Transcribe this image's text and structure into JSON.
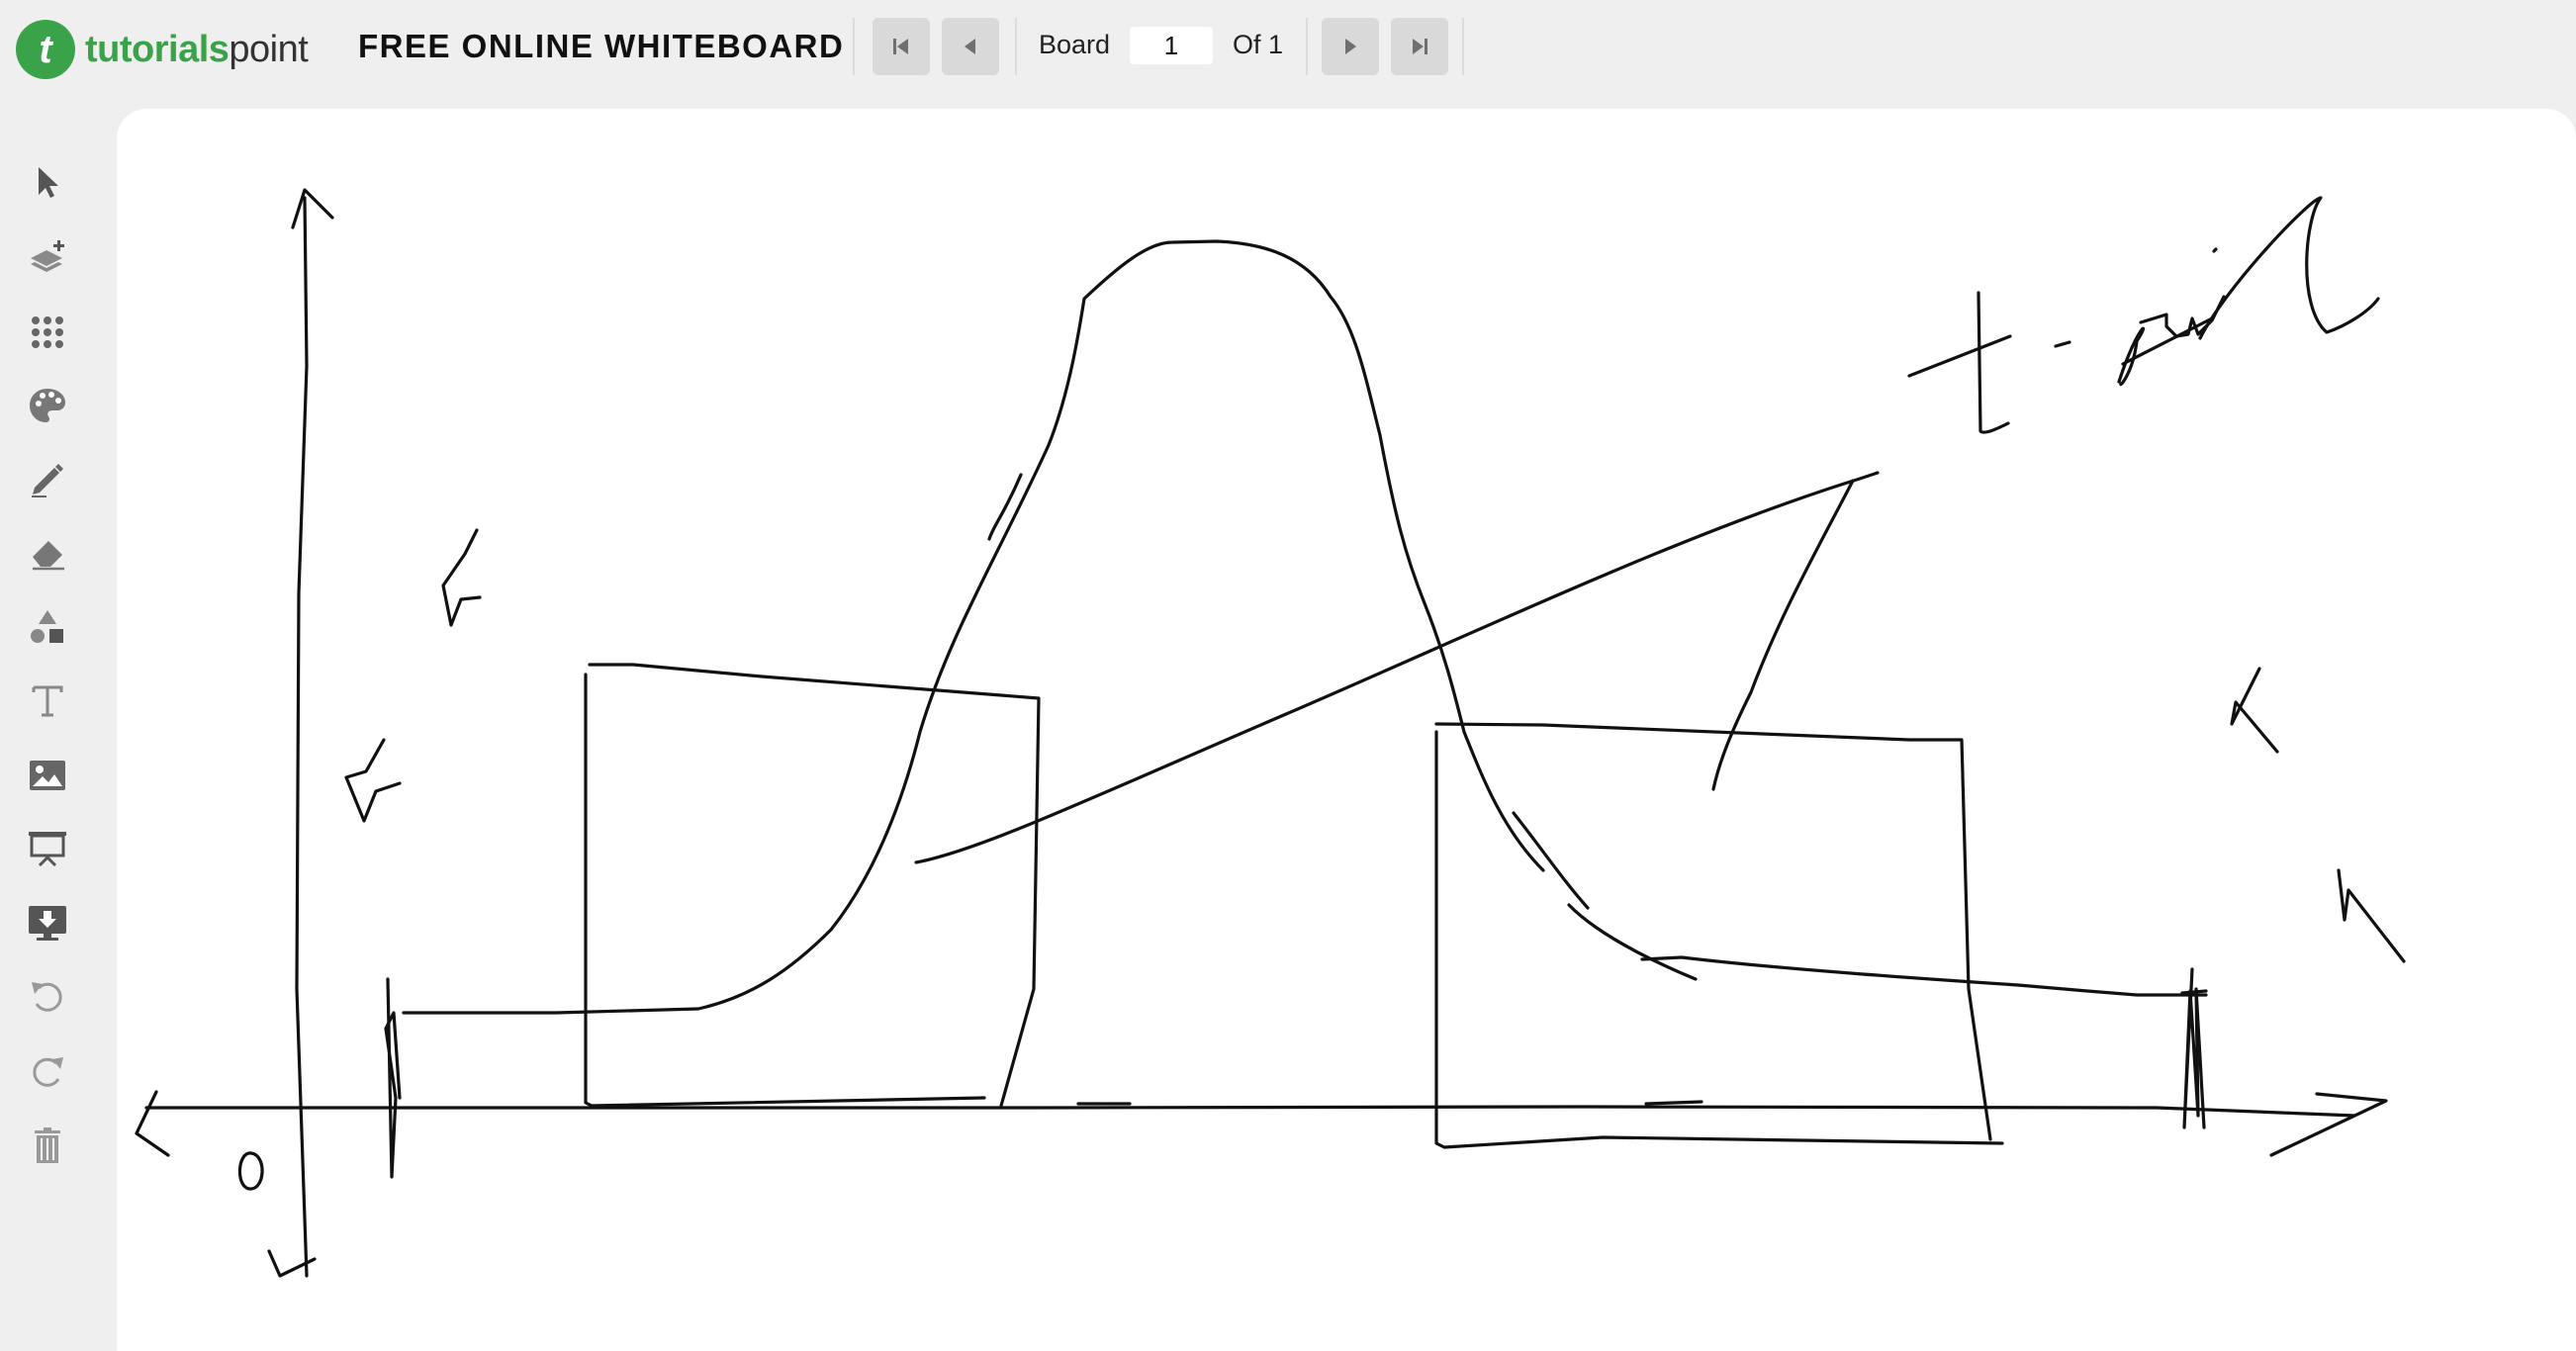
{
  "header": {
    "logo_text_strong": "tutorials",
    "logo_text_thin": "point",
    "app_title": "FREE ONLINE WHITEBOARD",
    "board_label": "Board",
    "board_page": "1",
    "board_of": "Of 1"
  },
  "nav_buttons": [
    "first-page-icon",
    "previous-page-icon",
    "next-page-icon",
    "last-page-icon"
  ],
  "sidebar": {
    "tools": [
      "select-cursor-icon",
      "add-layer-icon",
      "dot-grid-icon",
      "color-palette-icon",
      "pencil-icon",
      "eraser-icon",
      "shapes-icon",
      "text-icon",
      "image-icon",
      "presentation-icon",
      "download-board-icon",
      "undo-icon",
      "redo-icon",
      "delete-icon"
    ]
  },
  "canvas": {
    "handwritten_labels": [
      "0",
      "t-tail"
    ]
  },
  "colors": {
    "brand": "#3aa34a",
    "header_bg": "#efefef",
    "canvas_bg": "#ffffff",
    "icon_gray": "#7a7a7a",
    "ink": "#111111"
  }
}
